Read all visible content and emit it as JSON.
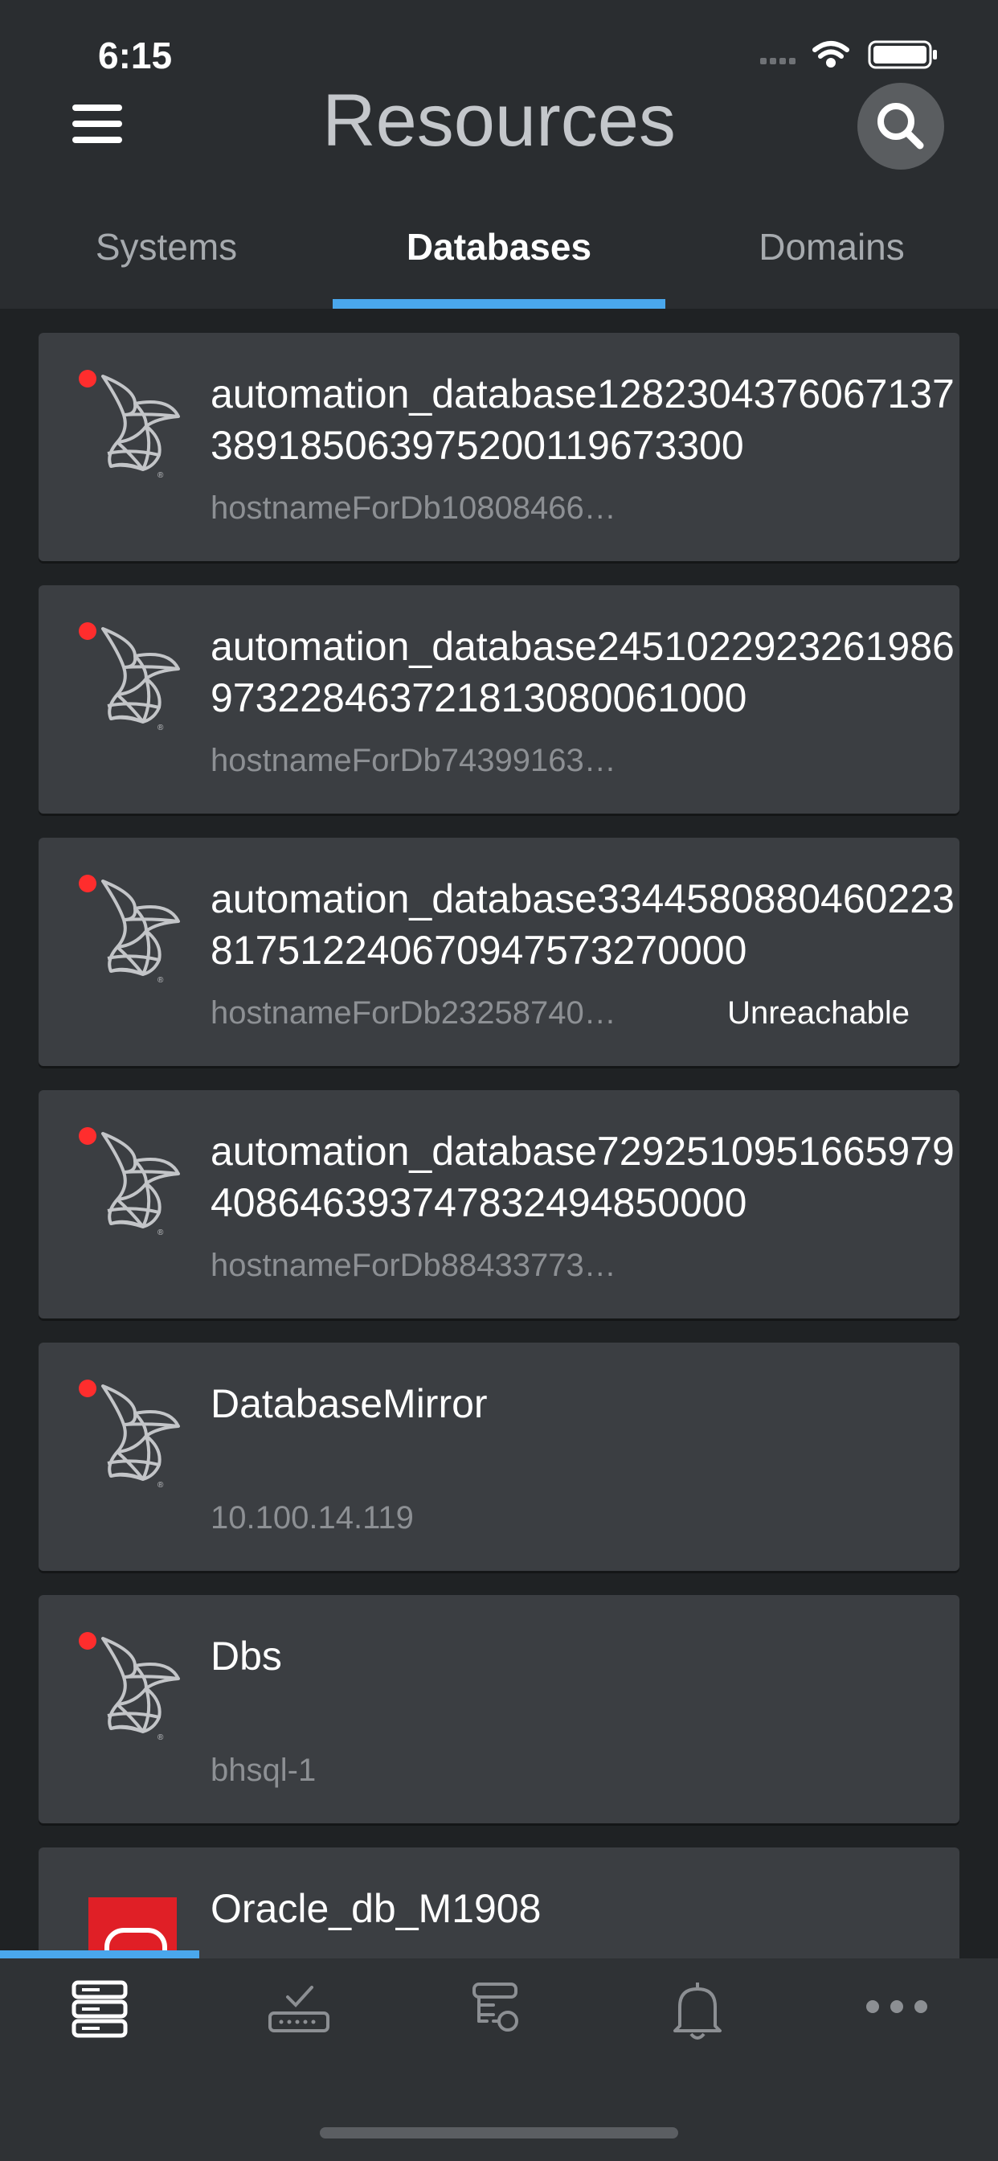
{
  "status_bar": {
    "time": "6:15",
    "icons": [
      "signal-icon",
      "wifi-icon",
      "battery-icon"
    ]
  },
  "header": {
    "title": "Resources",
    "menu_icon": "hamburger-menu-icon",
    "search_icon": "search-icon"
  },
  "tabs": [
    {
      "label": "Systems",
      "active": false
    },
    {
      "label": "Databases",
      "active": true
    },
    {
      "label": "Domains",
      "active": false
    }
  ],
  "databases": [
    {
      "title": "automation_database1282304376067137389185063975200119673300",
      "subtitle": "hostnameForDb10808466…",
      "badge": "",
      "icon": "sql-server-icon",
      "status_color": "#ff2d2d"
    },
    {
      "title": "automation_database2451022923261986973228463721813080061000",
      "subtitle": "hostnameForDb74399163…",
      "badge": "",
      "icon": "sql-server-icon",
      "status_color": "#ff2d2d"
    },
    {
      "title": "automation_database3344580880460223817512240670947573270000",
      "subtitle": "hostnameForDb23258740…",
      "badge": "Unreachable",
      "icon": "sql-server-icon",
      "status_color": "#ff2d2d"
    },
    {
      "title": "automation_database7292510951665979408646393747832494850000",
      "subtitle": "hostnameForDb88433773…",
      "badge": "",
      "icon": "sql-server-icon",
      "status_color": "#ff2d2d"
    },
    {
      "title": "DatabaseMirror",
      "subtitle": "10.100.14.119",
      "badge": "",
      "icon": "sql-server-icon",
      "status_color": "#ff2d2d"
    },
    {
      "title": "Dbs",
      "subtitle": "bhsql-1",
      "badge": "",
      "icon": "sql-server-icon",
      "status_color": "#ff2d2d"
    },
    {
      "title": "Oracle_db_M1908",
      "subtitle": "",
      "badge": "",
      "icon": "oracle-icon",
      "status_color": ""
    }
  ],
  "bottom_nav": [
    {
      "icon": "servers-icon",
      "active": true
    },
    {
      "icon": "checklist-icon",
      "active": false
    },
    {
      "icon": "keys-icon",
      "active": false
    },
    {
      "icon": "bell-icon",
      "active": false
    },
    {
      "icon": "more-icon",
      "active": false
    }
  ],
  "colors": {
    "accent": "#4aa7ec",
    "status_red": "#ff2d2d",
    "header_bg": "#2a2d30",
    "card_bg": "#3b3e42"
  }
}
